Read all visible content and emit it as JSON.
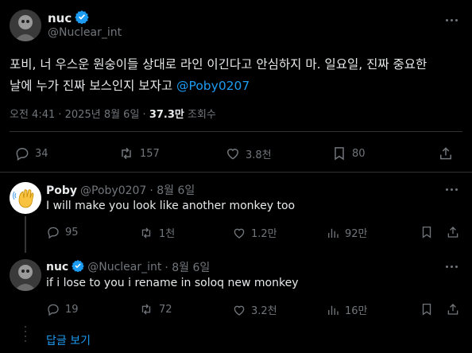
{
  "main_tweet": {
    "author_name": "nuc",
    "author_handle": "@Nuclear_int",
    "text_line1": "포비, 너 우스운 원숭이들 상대로 라인 이긴다고 안심하지 마. 일요일, 진짜 중요한",
    "text_line2": "날에 누가 진짜 보스인지 보자고 ",
    "mention": "@Poby0207",
    "time": "오전 4:41 · 2025년 8월 6일 · ",
    "views_count": "37.3만",
    "views_label": " 조회수",
    "stats": {
      "replies": "34",
      "retweets": "157",
      "likes": "3.8천",
      "bookmarks": "80"
    }
  },
  "replies": [
    {
      "author_name": "Poby",
      "author_handle": "@Poby0207",
      "date": "· 8월 6일",
      "text": "I will make you look like another monkey too",
      "stats": {
        "replies": "95",
        "retweets": "1천",
        "likes": "1.2만",
        "views": "92만"
      }
    },
    {
      "author_name": "nuc",
      "author_handle": "@Nuclear_int",
      "date": "· 8월 6일",
      "text": "if i lose to you i rename in soloq new monkey",
      "stats": {
        "replies": "19",
        "retweets": "72",
        "likes": "3.2천",
        "views": "16만"
      }
    }
  ],
  "show_replies_label": "답글 보기",
  "colors": {
    "accent": "#1d9bf0",
    "muted": "#71767b",
    "divider": "#2f3336",
    "background": "#000000"
  }
}
